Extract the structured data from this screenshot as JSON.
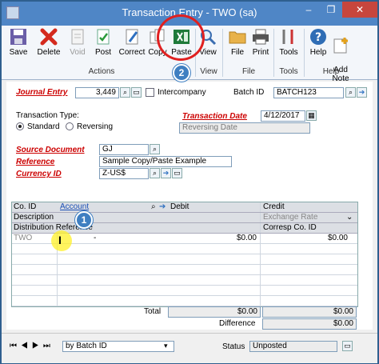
{
  "window": {
    "title": "Transaction Entry  -  TWO (sa)",
    "minimize": "–",
    "restore": "❐",
    "close": "✕"
  },
  "ribbon": {
    "save": "Save",
    "delete": "Delete",
    "void": "Void",
    "post": "Post",
    "correct": "Correct",
    "copy": "Copy",
    "paste": "Paste",
    "view": "View",
    "file": "File",
    "print": "Print",
    "tools": "Tools",
    "help": "Help",
    "add_note": "Add\nNote",
    "groups": {
      "actions": "Actions",
      "view": "View",
      "file": "File",
      "tools": "Tools",
      "help": "Help"
    }
  },
  "form": {
    "journal_entry_label": "Journal Entry",
    "journal_entry_value": "3,449",
    "intercompany_label": "Intercompany",
    "batch_id_label": "Batch ID",
    "batch_id_value": "BATCH123",
    "transaction_type_label": "Transaction Type:",
    "standard_label": "Standard",
    "reversing_label": "Reversing",
    "transaction_date_label": "Transaction Date",
    "transaction_date_value": "4/12/2017",
    "reversing_date_label": "Reversing Date",
    "source_document_label": "Source Document",
    "source_document_value": "GJ",
    "reference_label": "Reference",
    "reference_value": "Sample Copy/Paste Example",
    "currency_id_label": "Currency ID",
    "currency_id_value": "Z-US$"
  },
  "grid": {
    "co_id": "Co. ID",
    "account": "Account",
    "debit": "Debit",
    "credit": "Credit",
    "description": "Description",
    "exchange_rate": "Exchange Rate",
    "distribution_reference": "Distribution Reference",
    "corresp_co_id": "Corresp Co. ID",
    "row1": {
      "co_id": "TWO",
      "dash": "-",
      "debit": "$0.00",
      "credit": "$0.00"
    }
  },
  "totals": {
    "total_label": "Total",
    "total_debit": "$0.00",
    "total_credit": "$0.00",
    "difference_label": "Difference",
    "difference_value": "$0.00"
  },
  "footer": {
    "sort_value": "by Batch ID",
    "status_label": "Status",
    "status_value": "Unposted"
  },
  "callouts": {
    "one": "1",
    "two": "2"
  },
  "colors": {
    "titlebar": "#4f86c6",
    "required_label": "#cc0000",
    "callout": "#3f7fc1",
    "highlight_ring": "#e02020"
  }
}
